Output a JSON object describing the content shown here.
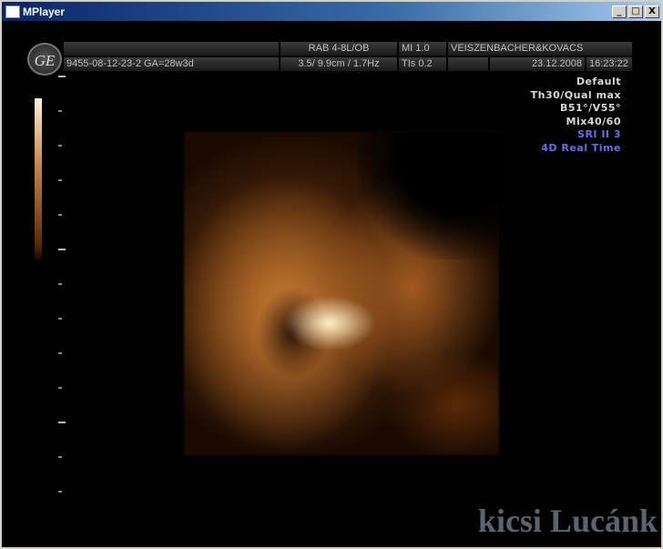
{
  "window": {
    "title": "MPlayer",
    "controls": [
      "_",
      "□",
      "X"
    ]
  },
  "header": {
    "logo": "GE",
    "row1": {
      "blank": "",
      "probe": "RAB 4-8L/OB",
      "mi": "MI  1.0",
      "clinic": "VEISZENBACHER&KOVACS"
    },
    "row2": {
      "patient": "9455-08-12-23-2  GA=28w3d",
      "params": "3.5/ 9.9cm / 1.7Hz",
      "tis": "TIs  0.2",
      "blank": "",
      "date": "23.12.2008",
      "time": "16:23:22"
    }
  },
  "settings": {
    "lines": [
      "Default",
      "Th30/Qual max",
      "B51°/V55°",
      "Mix40/60"
    ],
    "blue_lines": [
      "SRI II 3",
      "4D Real Time"
    ]
  },
  "watermark": "kicsi Lucánk",
  "colors": {
    "settings_blue": "#6a6af0",
    "titlebar": "#0a246a"
  }
}
